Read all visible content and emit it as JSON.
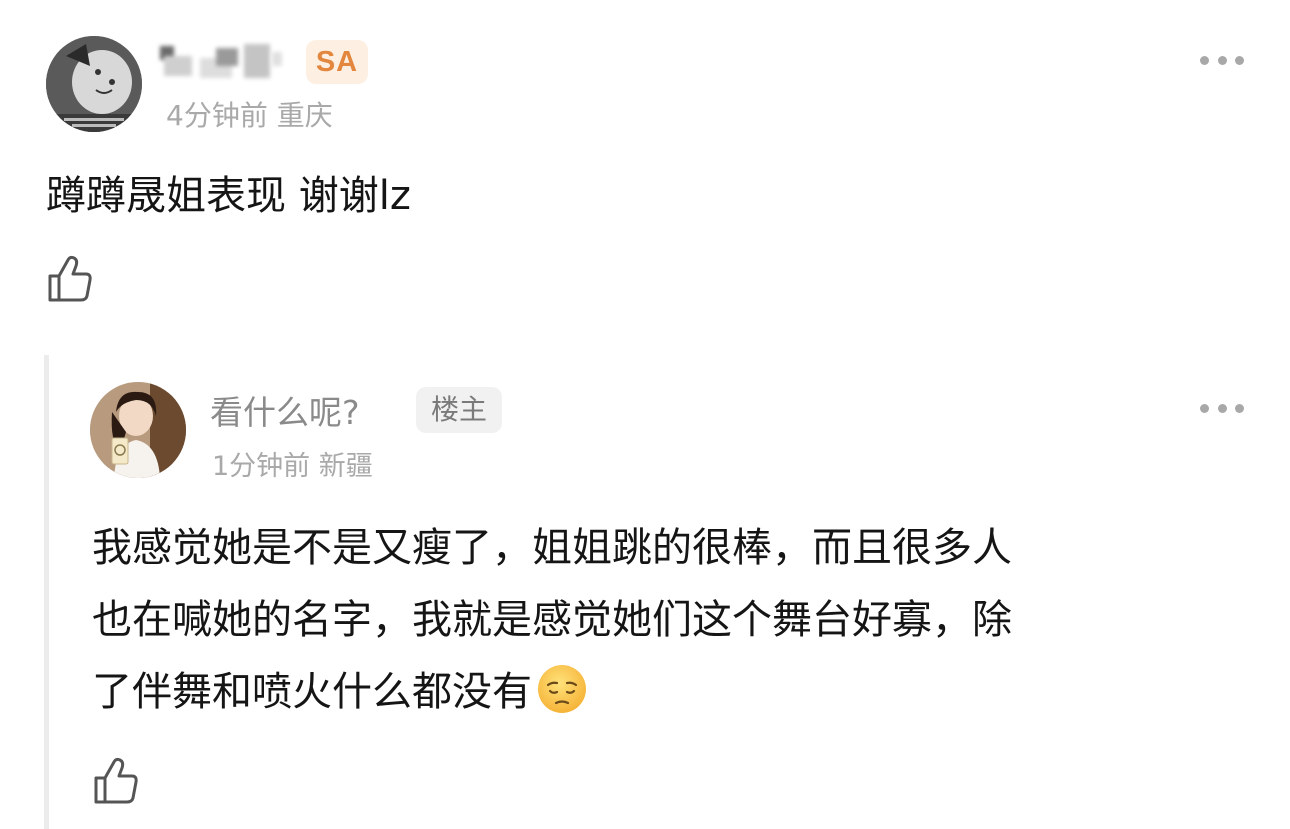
{
  "comment": {
    "badge": "SA",
    "meta": "4分钟前 重庆",
    "text": "蹲蹲晟姐表现 谢谢lz",
    "more_icon": "more-dots-icon",
    "like_icon": "thumb-up-icon"
  },
  "reply": {
    "username": "看什么呢?",
    "badge": "楼主",
    "meta": "1分钟前 新疆",
    "text_lines": [
      "我感觉她是不是又瘦了，姐姐跳的很棒，而且很多人",
      "也在喊她的名字，我就是感觉她们这个舞台好寡，除",
      "了伴舞和喷火什么都没有"
    ],
    "emoji": "pensive-face-icon",
    "more_icon": "more-dots-icon",
    "like_icon": "thumb-up-icon"
  },
  "colors": {
    "sa_badge_bg": "#fdf0e3",
    "sa_badge_text": "#e2873d",
    "meta_gray": "#a9a9a9",
    "owner_badge_bg": "#f1f1f1"
  }
}
